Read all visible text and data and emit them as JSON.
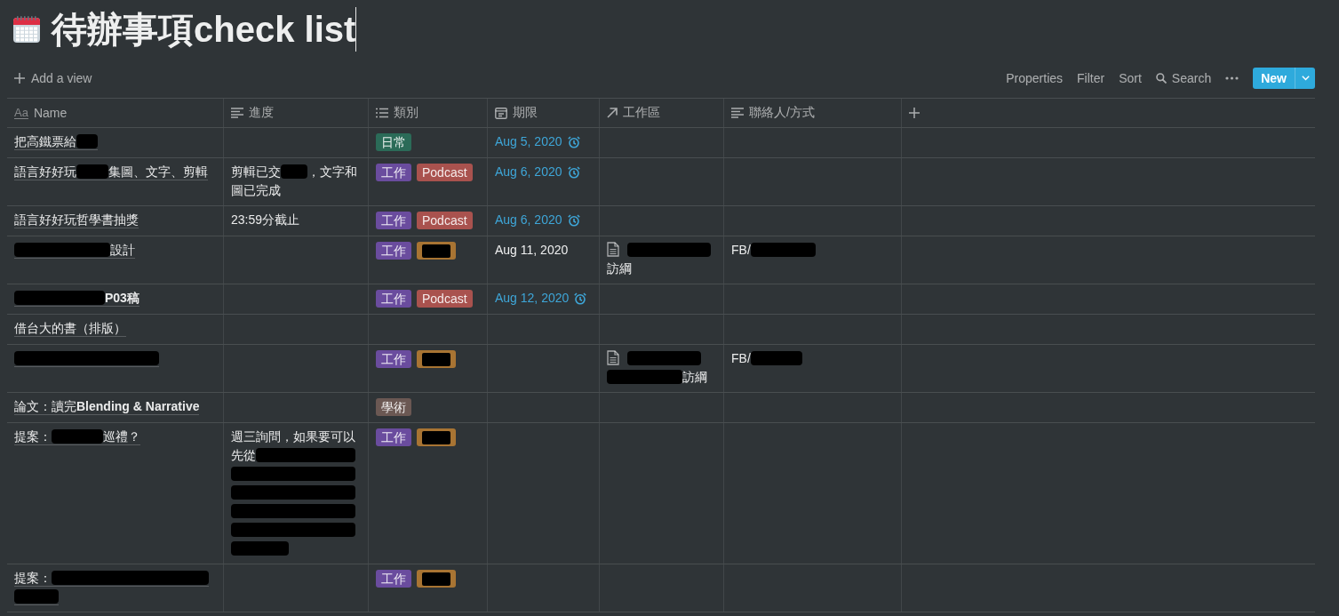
{
  "page": {
    "title": "待辦事項check list",
    "editing": true
  },
  "toolbar": {
    "add_view": "Add a view",
    "actions": [
      {
        "kind": "text",
        "label": "Properties"
      },
      {
        "kind": "text",
        "label": "Filter"
      },
      {
        "kind": "text",
        "label": "Sort"
      },
      {
        "kind": "search",
        "label": "Search"
      },
      {
        "kind": "more"
      }
    ],
    "new_button": "New"
  },
  "table": {
    "columns": [
      {
        "kind": "title",
        "glyph": "Aa",
        "label": "Name"
      },
      {
        "kind": "text",
        "label": "進度"
      },
      {
        "kind": "multi_select",
        "label": "類別"
      },
      {
        "kind": "date",
        "label": "期限"
      },
      {
        "kind": "relation",
        "label": "工作區"
      },
      {
        "kind": "text",
        "label": "聯絡人/方式"
      },
      {
        "kind": "add"
      }
    ],
    "rows": [
      {
        "name": [
          {
            "kind": "text",
            "text": "把高鐵票給"
          },
          {
            "kind": "redacted"
          }
        ],
        "categories": [
          {
            "kind": "label",
            "label": "日常",
            "color": "#2b6b58"
          }
        ],
        "due": {
          "text": "Aug 5, 2020",
          "reminder": true
        }
      },
      {
        "name": [
          {
            "kind": "text",
            "text": "語言好好玩"
          },
          {
            "kind": "redacted"
          },
          {
            "kind": "text",
            "text": "集圖、文字、剪輯"
          }
        ],
        "progress": [
          {
            "kind": "text",
            "text": "剪輯已交"
          },
          {
            "kind": "redacted"
          },
          {
            "kind": "text",
            "text": "，文字和"
          },
          {
            "kind": "text",
            "text": "圖已完成"
          }
        ],
        "categories": [
          {
            "kind": "label",
            "label": "工作",
            "color": "#6a4c9e"
          },
          {
            "kind": "label",
            "label": "Podcast",
            "color": "#a9524e"
          }
        ],
        "due": {
          "text": "Aug 6, 2020",
          "reminder": true
        }
      },
      {
        "name": [
          {
            "kind": "text",
            "text": "語言好好玩哲學書抽獎"
          }
        ],
        "progress": [
          {
            "kind": "text",
            "text": "23:59分截止"
          }
        ],
        "categories": [
          {
            "kind": "label",
            "label": "工作",
            "color": "#6a4c9e"
          },
          {
            "kind": "label",
            "label": "Podcast",
            "color": "#a9524e"
          }
        ],
        "due": {
          "text": "Aug 6, 2020",
          "reminder": true
        }
      },
      {
        "name": [
          {
            "kind": "redacted"
          },
          {
            "kind": "text",
            "text": "設計"
          }
        ],
        "categories": [
          {
            "kind": "label",
            "label": "工作",
            "color": "#6a4c9e"
          },
          {
            "kind": "redacted",
            "color": "#a87433"
          }
        ],
        "due": {
          "text": "Aug 11, 2020",
          "reminder": false
        },
        "workspace": [
          {
            "parts": [
              {
                "kind": "redacted"
              },
              {
                "kind": "text",
                "text": "訪綱"
              }
            ]
          }
        ],
        "contact": [
          {
            "kind": "text",
            "text": "FB/"
          },
          {
            "kind": "redacted"
          }
        ]
      },
      {
        "name": [
          {
            "kind": "redacted"
          },
          {
            "kind": "text",
            "text": "**P03稿**"
          }
        ],
        "categories": [
          {
            "kind": "label",
            "label": "工作",
            "color": "#6a4c9e"
          },
          {
            "kind": "label",
            "label": "Podcast",
            "color": "#a9524e"
          }
        ],
        "due": {
          "text": "Aug 12, 2020",
          "reminder": true
        }
      },
      {
        "name": [
          {
            "kind": "text",
            "text": "借台大的書（排版）"
          }
        ]
      },
      {
        "name": [
          {
            "kind": "redacted"
          }
        ],
        "categories": [
          {
            "kind": "label",
            "label": "工作",
            "color": "#6a4c9e"
          },
          {
            "kind": "redacted",
            "color": "#a87433"
          }
        ],
        "workspace": [
          {
            "parts": [
              {
                "kind": "redacted"
              },
              {
                "kind": "redacted"
              },
              {
                "kind": "text",
                "text": "訪綱"
              }
            ]
          }
        ],
        "contact": [
          {
            "kind": "text",
            "text": "FB/"
          },
          {
            "kind": "redacted"
          }
        ]
      },
      {
        "name": [
          {
            "kind": "text",
            "text": "論文：讀完**Blending & Narrative**"
          }
        ],
        "categories": [
          {
            "kind": "label",
            "label": "學術",
            "color": "#6b5853"
          }
        ]
      },
      {
        "name": [
          {
            "kind": "text",
            "text": "提案："
          },
          {
            "kind": "redacted"
          },
          {
            "kind": "text",
            "text": "巡禮？"
          }
        ],
        "progress": [
          {
            "kind": "text",
            "text": "週三詢問，如果要可以"
          },
          {
            "kind": "text",
            "text": "先從"
          },
          {
            "kind": "redacted"
          },
          {
            "kind": "redacted"
          },
          {
            "kind": "redacted"
          },
          {
            "kind": "redacted"
          },
          {
            "kind": "redacted"
          },
          {
            "kind": "redacted"
          }
        ],
        "categories": [
          {
            "kind": "label",
            "label": "工作",
            "color": "#6a4c9e"
          },
          {
            "kind": "redacted",
            "color": "#a87433"
          }
        ]
      },
      {
        "name": [
          {
            "kind": "text",
            "text": "提案："
          },
          {
            "kind": "redacted"
          },
          {
            "kind": "redacted"
          }
        ],
        "categories": [
          {
            "kind": "label",
            "label": "工作",
            "color": "#6a4c9e"
          },
          {
            "kind": "redacted",
            "color": "#a87433"
          }
        ]
      }
    ]
  }
}
